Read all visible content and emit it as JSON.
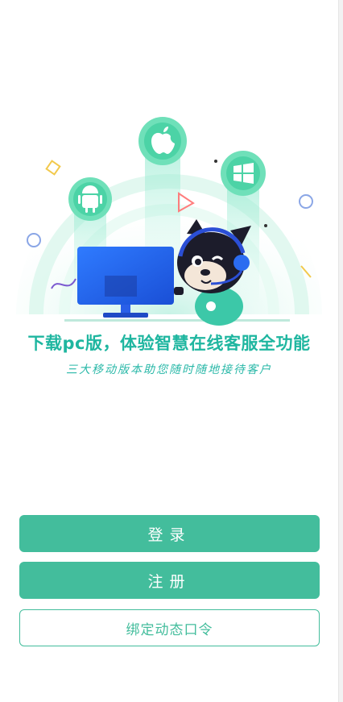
{
  "colors": {
    "accent": "#43bd9c",
    "headline": "#1fb6a0",
    "white": "#ffffff"
  },
  "hero": {
    "platform_icons": [
      "android-icon",
      "apple-icon",
      "windows-icon"
    ],
    "mascot": "mascot-with-headset"
  },
  "headline": "下载pc版，体验智慧在线客服全功能",
  "subline": "三大移动版本助您随时随地接待客户",
  "buttons": {
    "login": "登录",
    "register": "注册",
    "bind_dynamic_password": "绑定动态口令"
  }
}
